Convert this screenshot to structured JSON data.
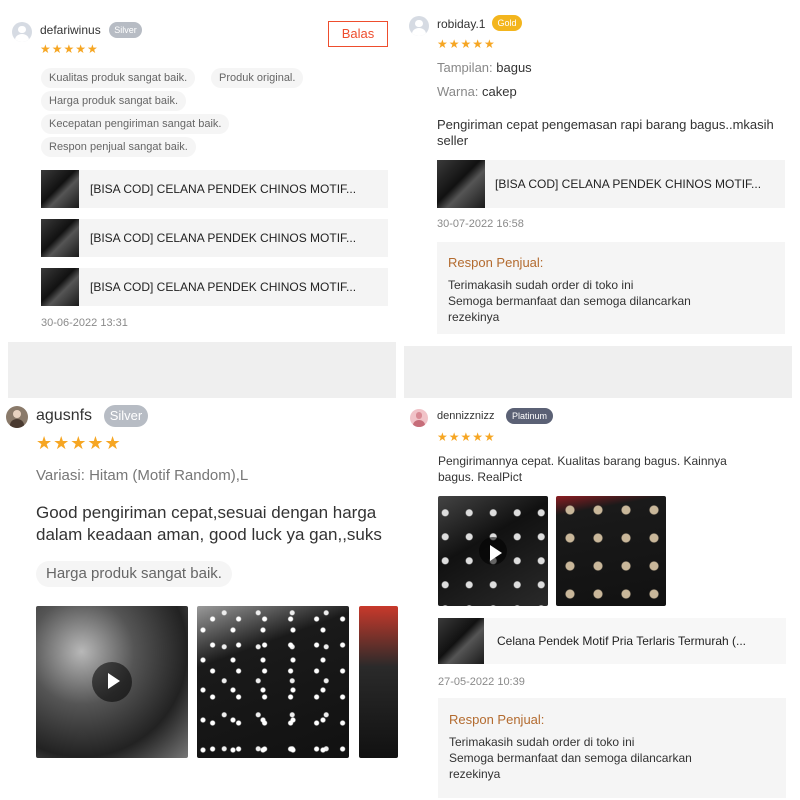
{
  "reviews": [
    {
      "username": "defariwinus",
      "badge": "Silver",
      "stars": "★★★★★",
      "reply_label": "Balas",
      "tags": [
        "Kualitas produk sangat baik.",
        "Produk original.",
        "Harga produk sangat baik.",
        "Kecepatan pengiriman sangat baik.",
        "Respon penjual sangat baik."
      ],
      "products": [
        "[BISA COD] CELANA PENDEK CHINOS MOTIF...",
        "[BISA COD] CELANA PENDEK CHINOS MOTIF...",
        "[BISA COD] CELANA PENDEK CHINOS MOTIF..."
      ],
      "timestamp": "30-06-2022 13:31"
    },
    {
      "username": "robiday.1",
      "badge": "Gold",
      "stars": "★★★★★",
      "attr_label_1": "Tampilan:",
      "attr_value_1": "bagus",
      "attr_label_2": "Warna:",
      "attr_value_2": "cakep",
      "comment": "Pengiriman cepat pengemasan rapi barang bagus..mkasih seller",
      "product": "[BISA COD] CELANA PENDEK CHINOS MOTIF...",
      "timestamp": "30-07-2022 16:58",
      "response_title": "Respon Penjual:",
      "response_text": [
        "Terimakasih sudah order di toko ini",
        "Semoga bermanfaat dan semoga dilancarkan",
        "rezekinya"
      ]
    },
    {
      "username": "agusnfs",
      "badge": "Silver",
      "stars": "★★★★★",
      "variation": "Variasi: Hitam (Motif Random),L",
      "comment_lines": [
        "Good pengiriman cepat,sesuai dengan harga",
        "dalam keadaan aman, good luck ya gan,,suks"
      ],
      "tag": "Harga produk sangat baik."
    },
    {
      "username": "dennizznizz",
      "badge": "Platinum",
      "stars": "★★★★★",
      "comment_lines": [
        "Pengirimannya cepat. Kualitas barang bagus. Kainnya",
        "bagus. RealPict"
      ],
      "product": "Celana Pendek Motif Pria Terlaris Termurah (...",
      "timestamp": "27-05-2022 10:39",
      "response_title": "Respon Penjual:",
      "response_text": [
        "Terimakasih sudah order di toko ini",
        "Semoga bermanfaat dan semoga dilancarkan",
        "rezekinya"
      ]
    }
  ],
  "colors": {
    "star": "#f6a623",
    "accent": "#ee4d2d",
    "response_title": "#b36b2f"
  },
  "icons": [
    "user-avatar-icon",
    "star-icon",
    "play-icon"
  ]
}
